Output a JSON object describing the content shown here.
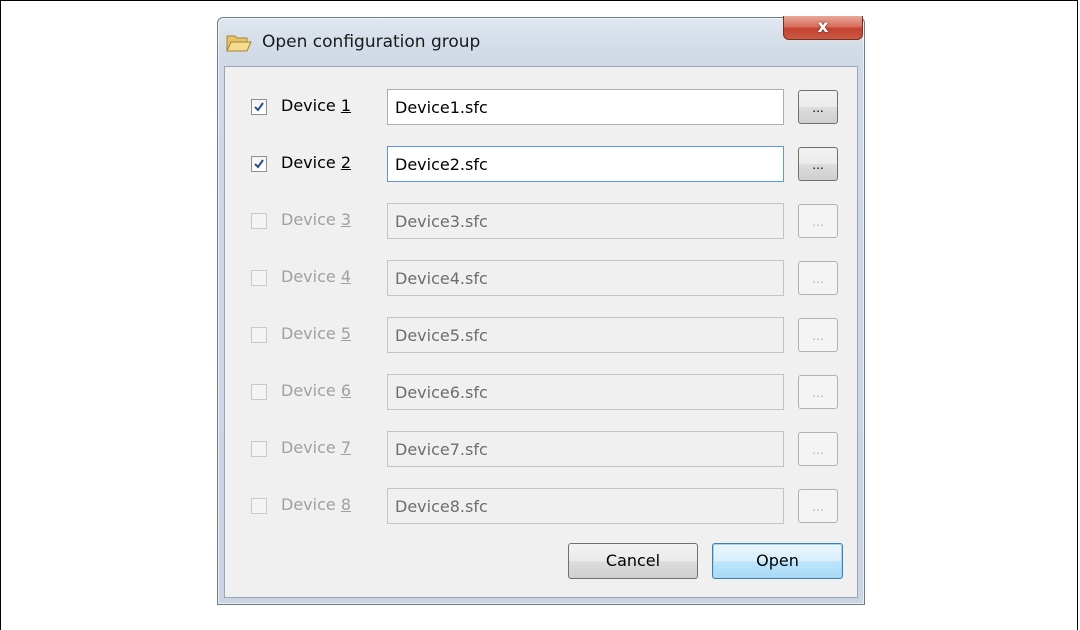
{
  "window": {
    "title": "Open configuration group",
    "close_glyph": "x"
  },
  "devices": [
    {
      "label": "Device ",
      "num": "1",
      "file": "Device1.sfc",
      "checked": true,
      "enabled": true,
      "focused": false,
      "browse": "..."
    },
    {
      "label": "Device ",
      "num": "2",
      "file": "Device2.sfc",
      "checked": true,
      "enabled": true,
      "focused": true,
      "browse": "..."
    },
    {
      "label": "Device ",
      "num": "3",
      "file": "Device3.sfc",
      "checked": false,
      "enabled": false,
      "focused": false,
      "browse": "..."
    },
    {
      "label": "Device ",
      "num": "4",
      "file": "Device4.sfc",
      "checked": false,
      "enabled": false,
      "focused": false,
      "browse": "..."
    },
    {
      "label": "Device ",
      "num": "5",
      "file": "Device5.sfc",
      "checked": false,
      "enabled": false,
      "focused": false,
      "browse": "..."
    },
    {
      "label": "Device ",
      "num": "6",
      "file": "Device6.sfc",
      "checked": false,
      "enabled": false,
      "focused": false,
      "browse": "..."
    },
    {
      "label": "Device ",
      "num": "7",
      "file": "Device7.sfc",
      "checked": false,
      "enabled": false,
      "focused": false,
      "browse": "..."
    },
    {
      "label": "Device ",
      "num": "8",
      "file": "Device8.sfc",
      "checked": false,
      "enabled": false,
      "focused": false,
      "browse": "..."
    }
  ],
  "buttons": {
    "cancel": "Cancel",
    "open": "Open"
  },
  "icons": {
    "title": "folder-open-icon",
    "close": "close-icon",
    "check": "checkmark-icon"
  },
  "colors": {
    "check": "#2a4f8f",
    "focus_border": "#5b9bd5",
    "close_button": "#c2432f"
  }
}
